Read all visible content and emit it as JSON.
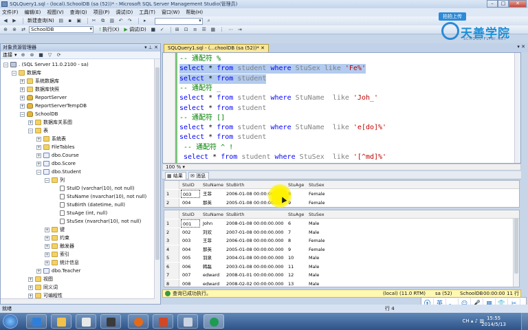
{
  "window": {
    "title": "SQLQuery1.sql - (local).SchoolDB (sa (52))* - Microsoft SQL Server Management Studio(管理员)"
  },
  "menu": [
    "文件(F)",
    "编辑(E)",
    "视图(V)",
    "查询(Q)",
    "项目(P)",
    "调试(D)",
    "工具(T)",
    "窗口(W)",
    "帮助(H)"
  ],
  "toolbar": {
    "new_query": "新建查询(N)",
    "database": "SchoolDB",
    "execute": "执行(X)",
    "debug": "调试(D)"
  },
  "brand": {
    "upload": "拍拍上传",
    "name": "天善学院",
    "url": "SCHOOL.FLYBI.NET"
  },
  "object_explorer": {
    "title": "对象资源管理器",
    "connect": "连接",
    "nodes": [
      {
        "label": ". (SQL Server 11.0.2100 - sa)",
        "level": 0,
        "exp": "-",
        "icon": "server"
      },
      {
        "label": "数据库",
        "level": 1,
        "exp": "-",
        "icon": "folder"
      },
      {
        "label": "系统数据库",
        "level": 2,
        "exp": "+",
        "icon": "folder"
      },
      {
        "label": "数据库快照",
        "level": 2,
        "exp": "+",
        "icon": "folder"
      },
      {
        "label": "ReportServer",
        "level": 2,
        "exp": "+",
        "icon": "db"
      },
      {
        "label": "ReportServerTempDB",
        "level": 2,
        "exp": "+",
        "icon": "db"
      },
      {
        "label": "SchoolDB",
        "level": 2,
        "exp": "-",
        "icon": "db"
      },
      {
        "label": "数据库关系图",
        "level": 3,
        "exp": "+",
        "icon": "folder"
      },
      {
        "label": "表",
        "level": 3,
        "exp": "-",
        "icon": "folder"
      },
      {
        "label": "系统表",
        "level": 4,
        "exp": "+",
        "icon": "folder"
      },
      {
        "label": "FileTables",
        "level": 4,
        "exp": "+",
        "icon": "folder"
      },
      {
        "label": "dbo.Course",
        "level": 4,
        "exp": "+",
        "icon": "table"
      },
      {
        "label": "dbo.Score",
        "level": 4,
        "exp": "+",
        "icon": "table"
      },
      {
        "label": "dbo.Student",
        "level": 4,
        "exp": "-",
        "icon": "table"
      },
      {
        "label": "列",
        "level": 5,
        "exp": "-",
        "icon": "folder"
      },
      {
        "label": "StuID (varchar(10), not null)",
        "level": 6,
        "exp": "",
        "icon": "col"
      },
      {
        "label": "StuName (nvarchar(10), not null)",
        "level": 6,
        "exp": "",
        "icon": "col"
      },
      {
        "label": "StuBirth (datetime, null)",
        "level": 6,
        "exp": "",
        "icon": "col"
      },
      {
        "label": "StuAge (int, null)",
        "level": 6,
        "exp": "",
        "icon": "col"
      },
      {
        "label": "StuSex (nvarchar(10), not null)",
        "level": 6,
        "exp": "",
        "icon": "col"
      },
      {
        "label": "键",
        "level": 5,
        "exp": "+",
        "icon": "folder"
      },
      {
        "label": "约束",
        "level": 5,
        "exp": "+",
        "icon": "folder"
      },
      {
        "label": "触发器",
        "level": 5,
        "exp": "+",
        "icon": "folder"
      },
      {
        "label": "索引",
        "level": 5,
        "exp": "+",
        "icon": "folder"
      },
      {
        "label": "统计信息",
        "level": 5,
        "exp": "+",
        "icon": "folder"
      },
      {
        "label": "dbo.Teacher",
        "level": 4,
        "exp": "+",
        "icon": "table"
      },
      {
        "label": "视图",
        "level": 3,
        "exp": "+",
        "icon": "folder"
      },
      {
        "label": "同义词",
        "level": 3,
        "exp": "+",
        "icon": "folder"
      },
      {
        "label": "可编程性",
        "level": 3,
        "exp": "+",
        "icon": "folder"
      }
    ]
  },
  "editor": {
    "tab_title": "SQLQuery1.sql - (...choolDB (sa (52))*",
    "zoom": "100 %",
    "lines": [
      {
        "cls": "cmt",
        "text": "-- 通配符 %",
        "sel": false
      },
      {
        "parts": [
          [
            "kw",
            "select "
          ],
          [
            "plain",
            "* "
          ],
          [
            "kw",
            "from "
          ],
          [
            "gray",
            "student "
          ],
          [
            "kw",
            "where "
          ],
          [
            "gray",
            "StuSex "
          ],
          [
            "gray",
            "like "
          ],
          [
            "str",
            "'Fe%'"
          ]
        ],
        "sel": true
      },
      {
        "parts": [
          [
            "kw",
            "select "
          ],
          [
            "plain",
            "* "
          ],
          [
            "kw",
            "from "
          ],
          [
            "gray",
            "student"
          ]
        ],
        "sel": true
      },
      {
        "cls": "cmt",
        "text": "-- 通配符 _",
        "sel": false
      },
      {
        "parts": [
          [
            "kw",
            "select "
          ],
          [
            "plain",
            "* "
          ],
          [
            "kw",
            "from "
          ],
          [
            "gray",
            "student "
          ],
          [
            "kw",
            "where "
          ],
          [
            "gray",
            "StuName  "
          ],
          [
            "gray",
            "like "
          ],
          [
            "str",
            "'Joh_'"
          ]
        ],
        "sel": false
      },
      {
        "parts": [
          [
            "kw",
            "select "
          ],
          [
            "plain",
            "* "
          ],
          [
            "kw",
            "from "
          ],
          [
            "gray",
            "student"
          ]
        ],
        "sel": false
      },
      {
        "cls": "cmt",
        "text": "-- 通配符 []",
        "sel": false
      },
      {
        "parts": [
          [
            "kw",
            "select "
          ],
          [
            "plain",
            "* "
          ],
          [
            "kw",
            "from "
          ],
          [
            "gray",
            "student "
          ],
          [
            "kw",
            "where "
          ],
          [
            "gray",
            "StuName  "
          ],
          [
            "gray",
            "like "
          ],
          [
            "str",
            "'e[do]%'"
          ]
        ],
        "sel": false
      },
      {
        "parts": [
          [
            "kw",
            "select "
          ],
          [
            "plain",
            "* "
          ],
          [
            "kw",
            "from "
          ],
          [
            "gray",
            "student"
          ]
        ],
        "sel": false
      },
      {
        "cls": "cmt",
        "text": " -- 通配符 ^ !",
        "sel": false
      },
      {
        "parts": [
          [
            "kw",
            " select "
          ],
          [
            "plain",
            "* "
          ],
          [
            "kw",
            "from "
          ],
          [
            "gray",
            "student "
          ],
          [
            "kw",
            "where "
          ],
          [
            "gray",
            "StuSex  "
          ],
          [
            "gray",
            "like "
          ],
          [
            "str",
            "'[^md]%'"
          ]
        ],
        "sel": false
      }
    ]
  },
  "results": {
    "tab_results": "结果",
    "tab_messages": "消息",
    "columns": [
      "StuID",
      "StuName",
      "StuBirth",
      "StuAge",
      "StuSex"
    ],
    "grid1": [
      [
        "1",
        "003",
        "王菲",
        "2006-01-08 00:00:00.000",
        "8",
        "Female"
      ],
      [
        "2",
        "004",
        "那英",
        "2005-01-08 00:00:00.000",
        "9",
        "Female"
      ]
    ],
    "grid2": [
      [
        "1",
        "001",
        "John",
        "2008-01-08 00:00:00.000",
        "6",
        "Male"
      ],
      [
        "2",
        "002",
        "刘欢",
        "2007-01-08 00:00:00.000",
        "7",
        "Male"
      ],
      [
        "3",
        "003",
        "王菲",
        "2006-01-08 00:00:00.000",
        "8",
        "Female"
      ],
      [
        "4",
        "004",
        "那英",
        "2005-01-08 00:00:00.000",
        "9",
        "Female"
      ],
      [
        "5",
        "005",
        "羽泉",
        "2004-01-08 00:00:00.000",
        "10",
        "Male"
      ],
      [
        "6",
        "006",
        "韩磊",
        "2003-01-08 00:00:00.000",
        "11",
        "Male"
      ],
      [
        "7",
        "007",
        "edward",
        "2008-01-01 00:00:00.000",
        "12",
        "Male"
      ],
      [
        "8",
        "008",
        "edward",
        "2008-02-02 00:00:00.000",
        "13",
        "Male"
      ]
    ]
  },
  "query_status": {
    "message": "查询已成功执行。",
    "server": "(local) (11.0 RTM)",
    "user": "sa (52)",
    "db": "SchoolDB",
    "time": "00:00:00",
    "rows": "11 行"
  },
  "status_bar": {
    "ready": "就绪",
    "row": "行 4",
    "col": "列 1",
    "ch": "Ch 1",
    "ins": "Ins"
  },
  "taskbar": {
    "time": "15:55",
    "date": "2014/5/13",
    "lang": "CH"
  },
  "ime": [
    "英",
    "。",
    "☺",
    "🎤",
    "▦",
    "👕",
    "✂"
  ]
}
